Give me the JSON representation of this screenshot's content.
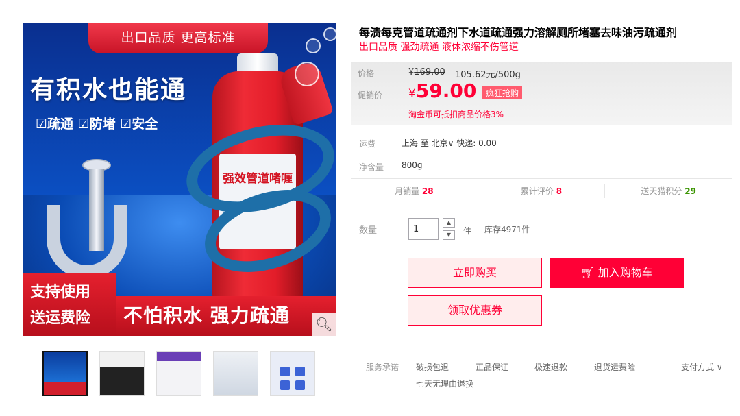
{
  "gallery": {
    "main_image": {
      "banner": "出口品质 更高标准",
      "headline": "有积水也能通",
      "features": "☑疏通 ☑防堵 ☑安全",
      "bottle_label": "强效管道啫喱",
      "promo_left_line1": "支持使用",
      "promo_left_line2": "送运费险",
      "promo_right": "不怕积水 强力疏通"
    },
    "thumbnail_count": 5
  },
  "product": {
    "title": "每渍每克管道疏通剂下水道疏通强力溶解厕所堵塞去味油污疏通剂",
    "subtitle": "出口品质 强劲疏通 液体浓缩不伤管道"
  },
  "price": {
    "label": "价格",
    "original_currency": "¥",
    "original_value": "169.00",
    "unit_price": "105.62元/500g",
    "promo_label": "促销价",
    "promo_currency": "¥",
    "promo_value": "59.00",
    "flash_tag": "疯狂抢购",
    "tmall_coin": "淘金币可抵扣商品价格3%"
  },
  "shipping": {
    "label": "运费",
    "value": "上海 至 北京∨ 快递: 0.00"
  },
  "net_content": {
    "label": "净含量",
    "value": "800g"
  },
  "stats": {
    "monthly_sales_label": "月销量",
    "monthly_sales_value": "28",
    "reviews_label": "累计评价",
    "reviews_value": "8",
    "points_label": "送天猫积分",
    "points_value": "29"
  },
  "quantity": {
    "label": "数量",
    "value": "1",
    "unit": "件",
    "stock": "库存4971件"
  },
  "buttons": {
    "buy_now": "立即购买",
    "add_to_cart": "加入购物车",
    "coupon": "领取优惠券"
  },
  "services": {
    "label": "服务承诺",
    "items": [
      "破损包退",
      "正品保证",
      "极速退款",
      "退货运费险",
      "七天无理由退换"
    ],
    "payment": "支付方式"
  },
  "colors": {
    "accent": "#ff0036",
    "points_green": "#3a9400",
    "button_light_bg": "#ffeded"
  }
}
